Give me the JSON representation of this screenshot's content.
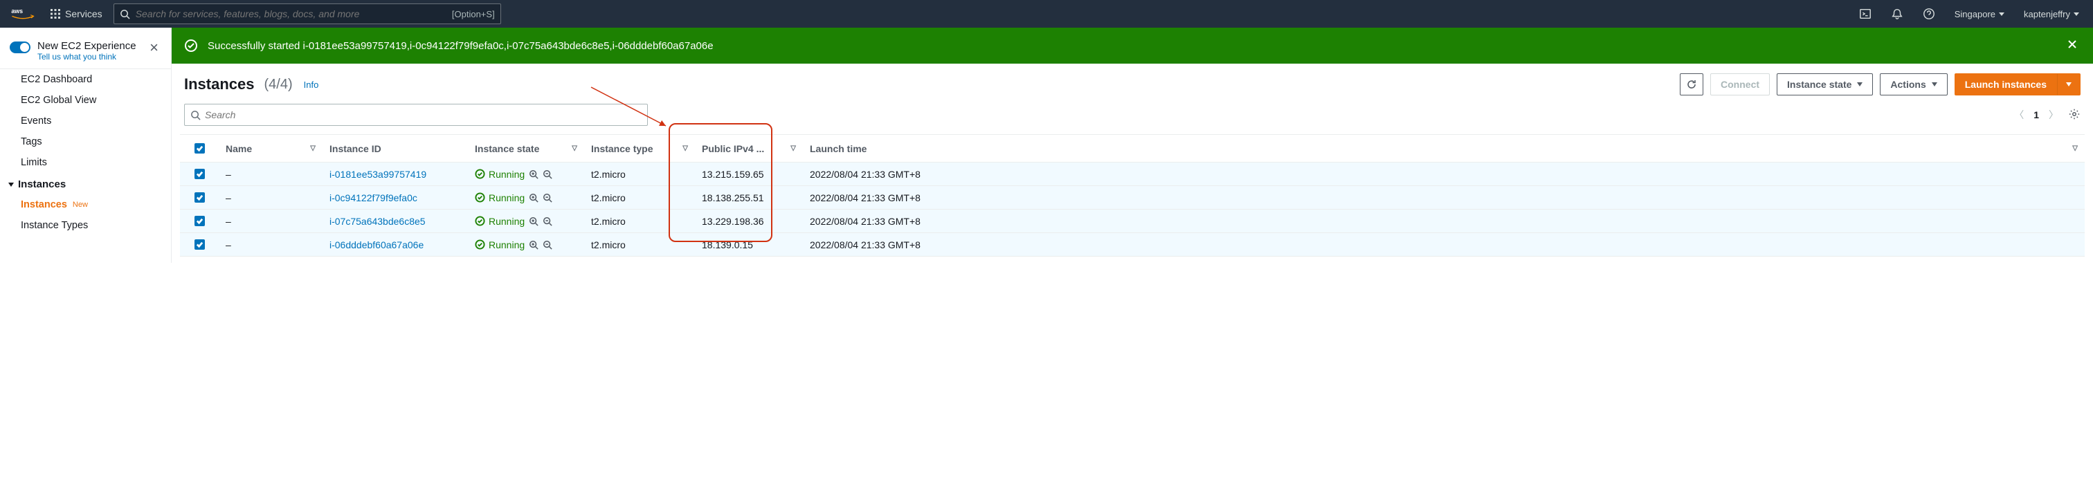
{
  "topnav": {
    "services_label": "Services",
    "search_placeholder": "Search for services, features, blogs, docs, and more",
    "search_shortcut": "[Option+S]",
    "region": "Singapore",
    "user": "kaptenjeffry"
  },
  "sidebar": {
    "toggle_title": "New EC2 Experience",
    "toggle_sub": "Tell us what you think",
    "items": [
      {
        "label": "EC2 Dashboard"
      },
      {
        "label": "EC2 Global View"
      },
      {
        "label": "Events"
      },
      {
        "label": "Tags"
      },
      {
        "label": "Limits"
      }
    ],
    "group": "Instances",
    "group_items": [
      {
        "label": "Instances",
        "active": true,
        "badge": "New"
      },
      {
        "label": "Instance Types"
      }
    ]
  },
  "flash": {
    "text": "Successfully started i-0181ee53a99757419,i-0c94122f79f9efa0c,i-07c75a643bde6c8e5,i-06dddebf60a67a06e"
  },
  "header": {
    "title": "Instances",
    "count": "(4/4)",
    "info": "Info",
    "refresh": "",
    "connect": "Connect",
    "instance_state": "Instance state",
    "actions": "Actions",
    "launch": "Launch instances"
  },
  "toolbar": {
    "search_placeholder": "Search",
    "page": "1"
  },
  "table": {
    "cols": {
      "name": "Name",
      "id": "Instance ID",
      "state": "Instance state",
      "type": "Instance type",
      "ipv4": "Public IPv4 ...",
      "launch": "Launch time"
    },
    "rows": [
      {
        "name": "–",
        "id": "i-0181ee53a99757419",
        "state": "Running",
        "type": "t2.micro",
        "ipv4": "13.215.159.65",
        "launch": "2022/08/04 21:33 GMT+8"
      },
      {
        "name": "–",
        "id": "i-0c94122f79f9efa0c",
        "state": "Running",
        "type": "t2.micro",
        "ipv4": "18.138.255.51",
        "launch": "2022/08/04 21:33 GMT+8"
      },
      {
        "name": "–",
        "id": "i-07c75a643bde6c8e5",
        "state": "Running",
        "type": "t2.micro",
        "ipv4": "13.229.198.36",
        "launch": "2022/08/04 21:33 GMT+8"
      },
      {
        "name": "–",
        "id": "i-06dddebf60a67a06e",
        "state": "Running",
        "type": "t2.micro",
        "ipv4": "18.139.0.15",
        "launch": "2022/08/04 21:33 GMT+8"
      }
    ]
  }
}
